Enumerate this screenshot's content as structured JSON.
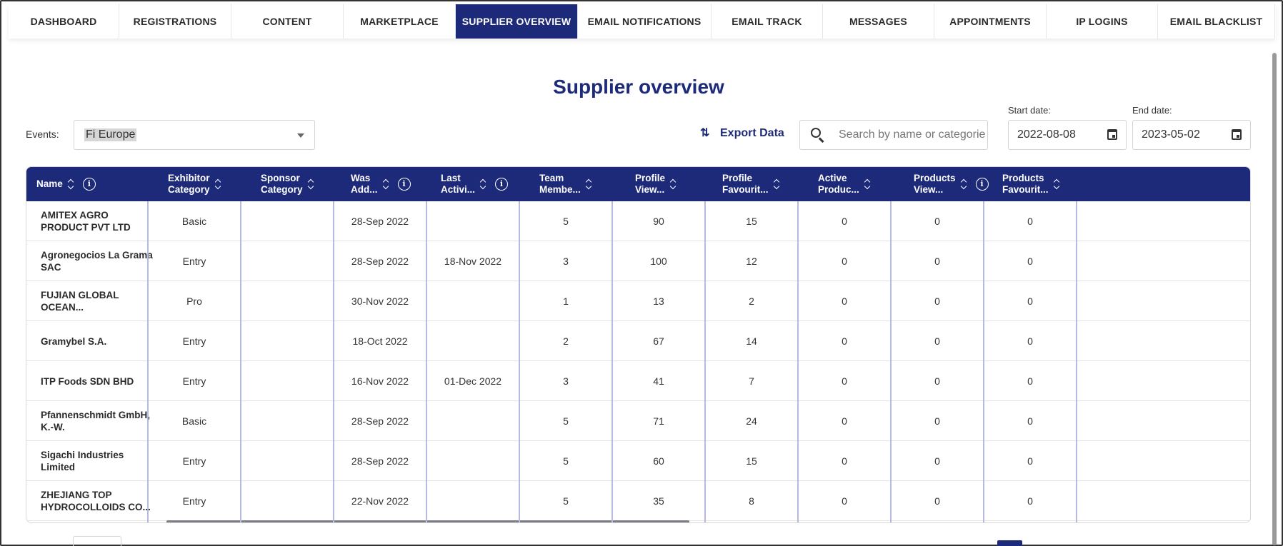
{
  "nav": {
    "items": [
      {
        "label": "DASHBOARD",
        "width": 155
      },
      {
        "label": "REGISTRATIONS",
        "width": 157
      },
      {
        "label": "CONTENT",
        "width": 157
      },
      {
        "label": "MARKETPLACE",
        "width": 157
      },
      {
        "label": "SUPPLIER OVERVIEW",
        "width": 171
      },
      {
        "label": "EMAIL NOTIFICATIONS",
        "width": 187
      },
      {
        "label": "EMAIL TRACK",
        "width": 156
      },
      {
        "label": "MESSAGES",
        "width": 156
      },
      {
        "label": "APPOINTMENTS",
        "width": 157
      },
      {
        "label": "IP LOGINS",
        "width": 156
      },
      {
        "label": "EMAIL BLACKLIST",
        "width": 164
      }
    ],
    "active_label": "SUPPLIER OVERVIEW"
  },
  "page": {
    "title": "Supplier overview"
  },
  "filters": {
    "events_label": "Events:",
    "events_value": "Fi Europe",
    "export_label": "Export Data",
    "search_placeholder": "Search by name or categorie",
    "start_label": "Start date:",
    "start_value": "2022-08-08",
    "end_label": "End date:",
    "end_value": "2023-05-02"
  },
  "table": {
    "columns": [
      {
        "label": "Name",
        "info": true
      },
      {
        "label": "Exhibitor\nCategory",
        "info": false
      },
      {
        "label": "Sponsor\nCategory",
        "info": false
      },
      {
        "label": "Was\nAdd...",
        "info": true
      },
      {
        "label": "Last\nActivi...",
        "info": true
      },
      {
        "label": "Team\nMembe...",
        "info": false
      },
      {
        "label": "Profile\nView...",
        "info": false
      },
      {
        "label": "Profile\nFavourit...",
        "info": false
      },
      {
        "label": "Active\nProduc...",
        "info": false
      },
      {
        "label": "Products\nView...",
        "info": true
      },
      {
        "label": "Products\nFavourit...",
        "info": false
      }
    ],
    "rows": [
      [
        "AMITEX AGRO\nPRODUCT PVT LTD",
        "Basic",
        "",
        "28-Sep 2022",
        "",
        "5",
        "90",
        "15",
        "0",
        "0",
        "0"
      ],
      [
        "Agronegocios La Grama\nSAC",
        "Entry",
        "",
        "28-Sep 2022",
        "18-Nov 2022",
        "3",
        "100",
        "12",
        "0",
        "0",
        "0"
      ],
      [
        "FUJIAN GLOBAL\nOCEAN...",
        "Pro",
        "",
        "30-Nov 2022",
        "",
        "1",
        "13",
        "2",
        "0",
        "0",
        "0"
      ],
      [
        "Gramybel S.A.",
        "Entry",
        "",
        "18-Oct 2022",
        "",
        "2",
        "67",
        "14",
        "0",
        "0",
        "0"
      ],
      [
        "ITP Foods SDN BHD",
        "Entry",
        "",
        "16-Nov 2022",
        "01-Dec 2022",
        "3",
        "41",
        "7",
        "0",
        "0",
        "0"
      ],
      [
        "Pfannenschmidt GmbH,\nK.-W.",
        "Basic",
        "",
        "28-Sep 2022",
        "",
        "5",
        "71",
        "24",
        "0",
        "0",
        "0"
      ],
      [
        "Sigachi Industries\nLimited",
        "Entry",
        "",
        "28-Sep 2022",
        "",
        "5",
        "60",
        "15",
        "0",
        "0",
        "0"
      ],
      [
        "ZHEJIANG TOP\nHYDROCOLLOIDS CO...",
        "Entry",
        "",
        "22-Nov 2022",
        "",
        "5",
        "35",
        "8",
        "0",
        "0",
        "0"
      ]
    ]
  },
  "colors": {
    "brand": "#1d2a7a",
    "divider": "#b6b9e0"
  }
}
